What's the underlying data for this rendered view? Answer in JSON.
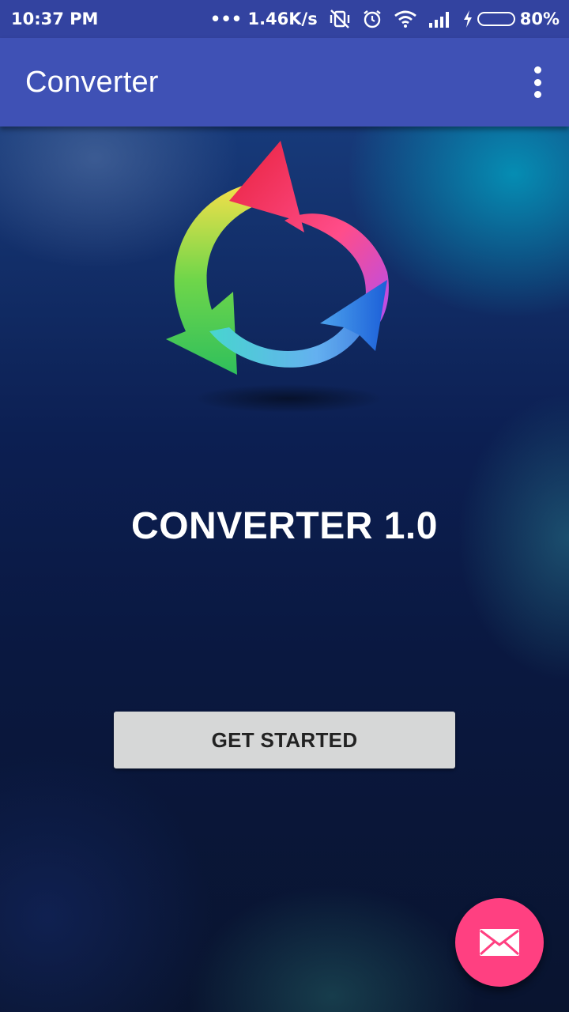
{
  "status_bar": {
    "time": "10:37 PM",
    "net_speed": "••• 1.46K/s",
    "battery_percent": "80%",
    "battery_level": 0.8,
    "icons": [
      "vibrate-off-icon",
      "alarm-icon",
      "wifi-icon",
      "signal-icon",
      "charging-icon",
      "battery-icon"
    ]
  },
  "app_bar": {
    "title": "Converter",
    "overflow_icon": "more-vert-icon"
  },
  "main": {
    "logo_icon": "converter-arrows-icon",
    "app_name": "CONVERTER 1.0",
    "get_started_label": "GET STARTED"
  },
  "fab": {
    "icon": "mail-icon",
    "color": "#ff4081"
  },
  "colors": {
    "status_bar": "#3343a0",
    "app_bar": "#3f51b5",
    "button": "#d6d7d7",
    "battery": "#35d14b"
  }
}
